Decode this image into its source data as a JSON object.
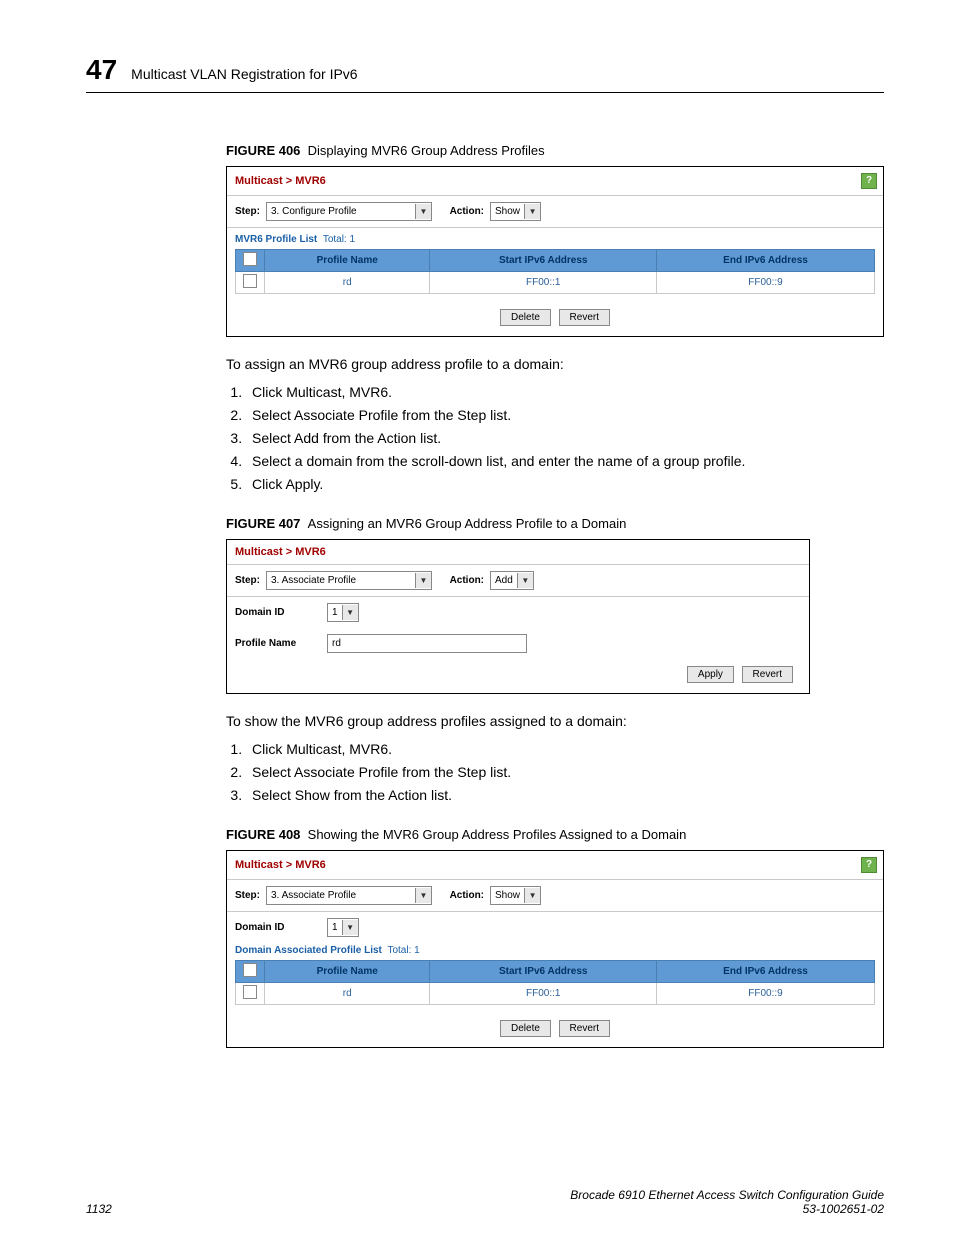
{
  "header": {
    "chapter_number": "47",
    "chapter_title": "Multicast VLAN Registration for IPv6"
  },
  "figure406": {
    "label": "FIGURE 406",
    "caption": "Displaying MVR6 Group Address Profiles",
    "nav": "Multicast > MVR6",
    "step_label": "Step:",
    "step_value": "3. Configure Profile",
    "action_label": "Action:",
    "action_value": "Show",
    "list_title": "MVR6 Profile List",
    "list_total_label": "Total:",
    "list_total": "1",
    "cols": {
      "c1": "Profile Name",
      "c2": "Start IPv6 Address",
      "c3": "End IPv6 Address"
    },
    "row": {
      "c1": "rd",
      "c2": "FF00::1",
      "c3": "FF00::9"
    },
    "btn_delete": "Delete",
    "btn_revert": "Revert"
  },
  "assign_intro": "To assign an MVR6 group address profile to a domain:",
  "assign_steps": {
    "s1": "Click Multicast, MVR6.",
    "s2": "Select Associate Profile from the Step list.",
    "s3": "Select Add from the Action list.",
    "s4": "Select a domain from the scroll-down list, and enter the name of a group profile.",
    "s5": "Click Apply."
  },
  "figure407": {
    "label": "FIGURE 407",
    "caption": "Assigning an MVR6 Group Address Profile to a Domain",
    "nav": "Multicast > MVR6",
    "step_label": "Step:",
    "step_value": "3. Associate Profile",
    "action_label": "Action:",
    "action_value": "Add",
    "domain_label": "Domain ID",
    "domain_value": "1",
    "profile_label": "Profile Name",
    "profile_value": "rd",
    "btn_apply": "Apply",
    "btn_revert": "Revert"
  },
  "show_intro": "To show the MVR6 group address profiles assigned to a domain:",
  "show_steps": {
    "s1": "Click Multicast, MVR6.",
    "s2": "Select Associate Profile from the Step list.",
    "s3": "Select Show from the Action list."
  },
  "figure408": {
    "label": "FIGURE 408",
    "caption": "Showing the MVR6 Group Address Profiles Assigned to a Domain",
    "nav": "Multicast > MVR6",
    "step_label": "Step:",
    "step_value": "3. Associate Profile",
    "action_label": "Action:",
    "action_value": "Show",
    "domain_label": "Domain ID",
    "domain_value": "1",
    "list_title": "Domain Associated Profile List",
    "list_total_label": "Total:",
    "list_total": "1",
    "cols": {
      "c1": "Profile Name",
      "c2": "Start IPv6 Address",
      "c3": "End IPv6 Address"
    },
    "row": {
      "c1": "rd",
      "c2": "FF00::1",
      "c3": "FF00::9"
    },
    "btn_delete": "Delete",
    "btn_revert": "Revert"
  },
  "footer": {
    "page": "1132",
    "doc_title": "Brocade 6910 Ethernet Access Switch Configuration Guide",
    "doc_number": "53-1002651-02"
  },
  "help_glyph": "?"
}
